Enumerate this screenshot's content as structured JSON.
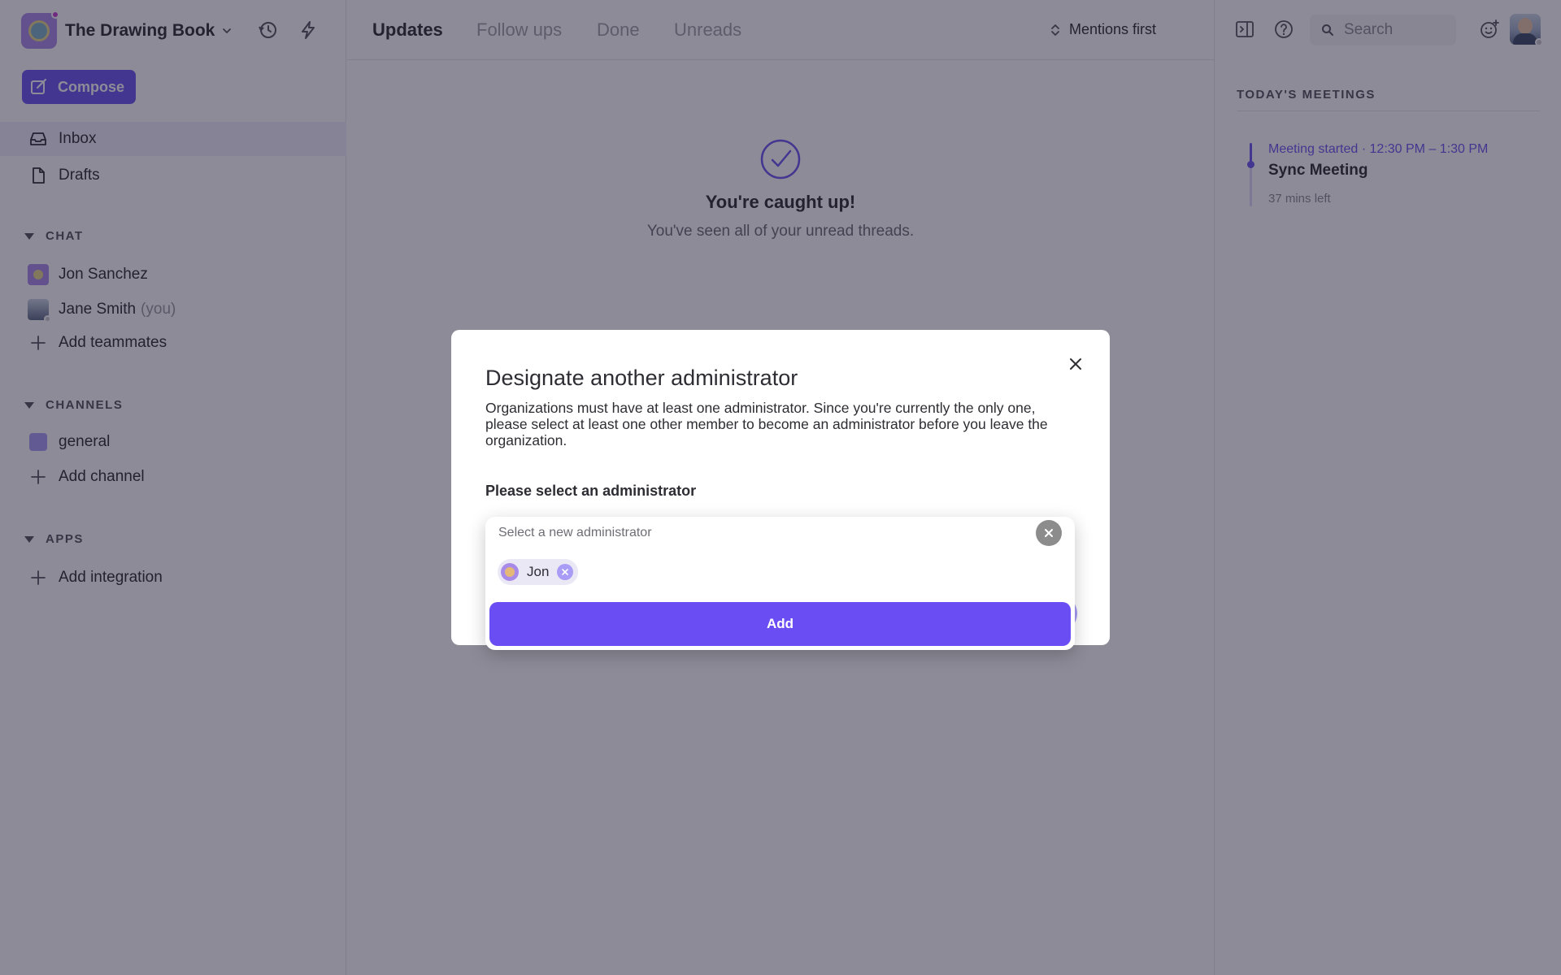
{
  "workspace": {
    "name": "The Drawing Book"
  },
  "sidebar": {
    "compose_label": "Compose",
    "nav": [
      {
        "label": "Inbox",
        "icon": "inbox-icon",
        "active": true
      },
      {
        "label": "Drafts",
        "icon": "document-icon",
        "active": false
      }
    ],
    "sections": {
      "chat": {
        "title": "CHAT",
        "members": [
          {
            "name": "Jon Sanchez",
            "suffix": ""
          },
          {
            "name": "Jane Smith",
            "suffix": "(you)"
          }
        ],
        "add_label": "Add teammates"
      },
      "channels": {
        "title": "CHANNELS",
        "items": [
          {
            "name": "general"
          }
        ],
        "add_label": "Add channel"
      },
      "apps": {
        "title": "APPS",
        "add_label": "Add integration"
      }
    }
  },
  "main": {
    "tabs": [
      {
        "label": "Updates",
        "active": true
      },
      {
        "label": "Follow ups",
        "active": false
      },
      {
        "label": "Done",
        "active": false
      },
      {
        "label": "Unreads",
        "active": false
      }
    ],
    "sort_label": "Mentions first",
    "empty_state": {
      "title": "You're caught up!",
      "subtitle": "You've seen all of your unread threads."
    }
  },
  "right_panel": {
    "search_placeholder": "Search",
    "meetings_title": "TODAY'S MEETINGS",
    "meeting": {
      "status": "Meeting started",
      "separator": "·",
      "time": "12:30 PM – 1:30 PM",
      "title": "Sync Meeting",
      "remaining": "37 mins left",
      "progress": 0.33
    }
  },
  "modal": {
    "title": "Designate another administrator",
    "description": "Organizations must have at least one administrator. Since you're currently the only one, please select at least one other member to become an administrator before you leave the organization.",
    "select_label": "Please select an administrator",
    "dropdown": {
      "placeholder": "Select a new administrator",
      "selected": [
        {
          "name": "Jon"
        }
      ],
      "add_label": "Add"
    }
  },
  "colors": {
    "accent": "#6b54f0",
    "overlay": "#1c1830"
  }
}
